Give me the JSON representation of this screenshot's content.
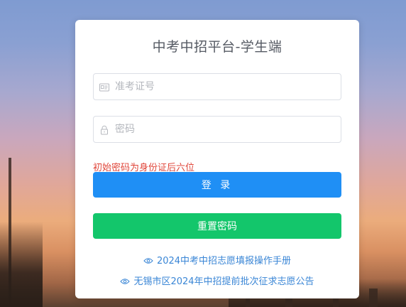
{
  "app": {
    "title": "中考中招平台-学生端"
  },
  "form": {
    "exam_id_placeholder": "准考证号",
    "password_placeholder": "密码",
    "hint": "初始密码为身份证后六位",
    "login_label": "登 录",
    "reset_label": "重置密码"
  },
  "links": [
    {
      "label": "2024中考中招志愿填报操作手册",
      "icon": "eye-icon"
    },
    {
      "label": "无锡市区2024年中招提前批次征求志愿公告",
      "icon": "eye-icon"
    }
  ],
  "colors": {
    "login_button": "#1f8ff5",
    "reset_button": "#13c66b",
    "hint_text": "#e0463a",
    "link_text": "#3a86d6"
  }
}
